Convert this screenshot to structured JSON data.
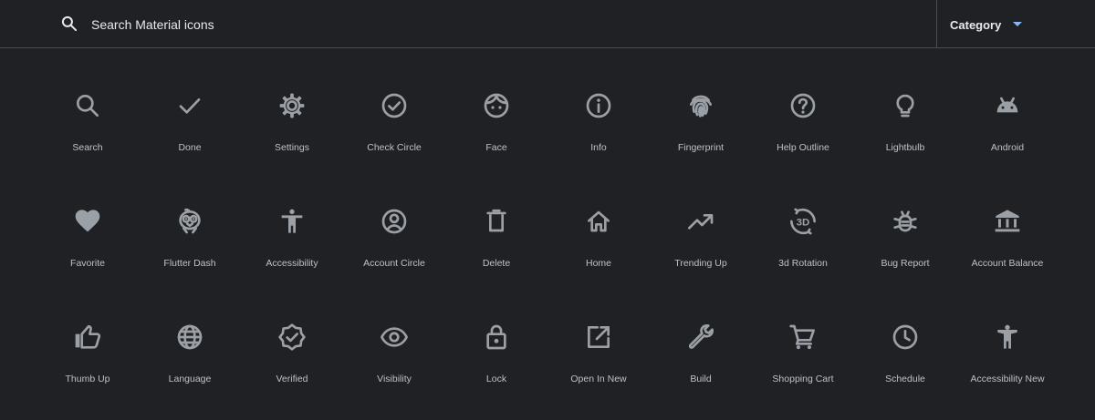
{
  "search": {
    "placeholder": "Search Material icons",
    "icon": "search-icon"
  },
  "category": {
    "label": "Category",
    "icon": "arrow-drop-down-icon",
    "accent": "#8ab4f8"
  },
  "colors": {
    "background": "#202124",
    "icon": "#9aa0a6",
    "label": "#bdc1c6"
  },
  "icons": [
    {
      "name": "search",
      "label": "Search"
    },
    {
      "name": "done",
      "label": "Done"
    },
    {
      "name": "settings",
      "label": "Settings"
    },
    {
      "name": "check-circle",
      "label": "Check Circle"
    },
    {
      "name": "face",
      "label": "Face"
    },
    {
      "name": "info",
      "label": "Info"
    },
    {
      "name": "fingerprint",
      "label": "Fingerprint"
    },
    {
      "name": "help-outline",
      "label": "Help Outline"
    },
    {
      "name": "lightbulb",
      "label": "Lightbulb"
    },
    {
      "name": "android",
      "label": "Android"
    },
    {
      "name": "favorite",
      "label": "Favorite"
    },
    {
      "name": "flutter-dash",
      "label": "Flutter Dash"
    },
    {
      "name": "accessibility",
      "label": "Accessibility"
    },
    {
      "name": "account-circle",
      "label": "Account Circle"
    },
    {
      "name": "delete",
      "label": "Delete"
    },
    {
      "name": "home",
      "label": "Home"
    },
    {
      "name": "trending-up",
      "label": "Trending Up"
    },
    {
      "name": "3d-rotation",
      "label": "3d Rotation",
      "glyph_text": "3D"
    },
    {
      "name": "bug-report",
      "label": "Bug Report"
    },
    {
      "name": "account-balance",
      "label": "Account Balance"
    },
    {
      "name": "thumb-up",
      "label": "Thumb Up"
    },
    {
      "name": "language",
      "label": "Language"
    },
    {
      "name": "verified",
      "label": "Verified"
    },
    {
      "name": "visibility",
      "label": "Visibility"
    },
    {
      "name": "lock",
      "label": "Lock"
    },
    {
      "name": "open-in-new",
      "label": "Open In New"
    },
    {
      "name": "build",
      "label": "Build"
    },
    {
      "name": "shopping-cart",
      "label": "Shopping Cart"
    },
    {
      "name": "schedule",
      "label": "Schedule"
    },
    {
      "name": "accessibility-new",
      "label": "Accessibility New"
    }
  ]
}
